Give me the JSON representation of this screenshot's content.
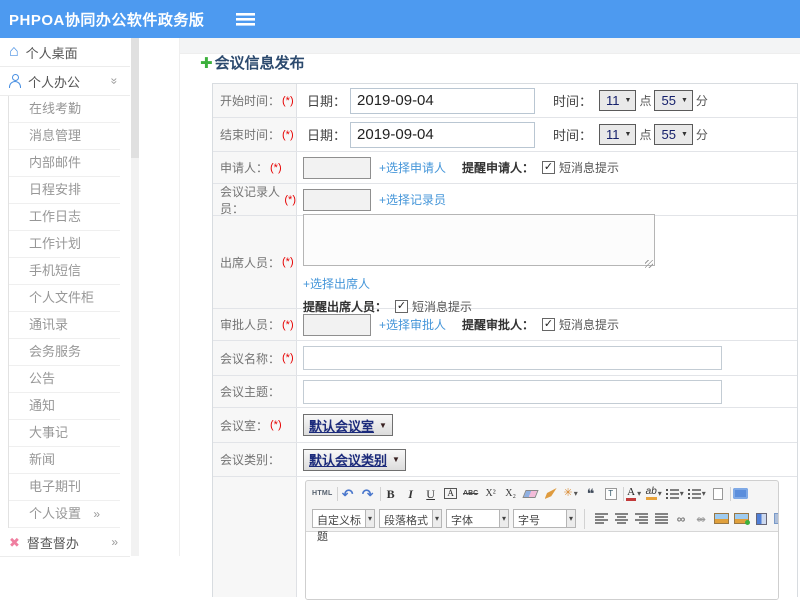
{
  "colors": {
    "header_bg": "#4d9af0",
    "link": "#4596d9",
    "required": "#e60000",
    "title": "#2c4a6e",
    "icon_blue": "#4a90e2",
    "plus_green": "#3cb03c",
    "supervise_pink": "#ef7fa0",
    "select_text": "#1b2a7b"
  },
  "header": {
    "app_title": "PHPOA协同办公软件政务版",
    "menu_icon": "hamburger-icon"
  },
  "sidebar": {
    "desktop": {
      "label": "个人桌面",
      "icon": "home-icon",
      "home_glyph": "⌂"
    },
    "office": {
      "label": "个人办公",
      "icon": "user-icon",
      "chevron": "»"
    },
    "submenu": [
      {
        "name": "sidebar-item-online-attendance",
        "label": "在线考勤"
      },
      {
        "name": "sidebar-item-message-management",
        "label": "消息管理"
      },
      {
        "name": "sidebar-item-internal-mail",
        "label": "内部邮件"
      },
      {
        "name": "sidebar-item-schedule",
        "label": "日程安排"
      },
      {
        "name": "sidebar-item-work-log",
        "label": "工作日志"
      },
      {
        "name": "sidebar-item-work-plan",
        "label": "工作计划"
      },
      {
        "name": "sidebar-item-mobile-sms",
        "label": "手机短信"
      },
      {
        "name": "sidebar-item-personal-cabinet",
        "label": "个人文件柜"
      },
      {
        "name": "sidebar-item-contacts",
        "label": "通讯录"
      },
      {
        "name": "sidebar-item-meeting-service",
        "label": "会务服务"
      },
      {
        "name": "sidebar-item-announcement",
        "label": "公告"
      },
      {
        "name": "sidebar-item-notice",
        "label": "通知"
      },
      {
        "name": "sidebar-item-memorabilia",
        "label": "大事记"
      },
      {
        "name": "sidebar-item-news",
        "label": "新闻"
      },
      {
        "name": "sidebar-item-e-journal",
        "label": "电子期刊"
      },
      {
        "name": "sidebar-item-personal-settings",
        "label": "个人设置",
        "chevron": "»"
      }
    ],
    "supervise": {
      "label": "督查督办",
      "icon": "supervise-icon",
      "glyph": "✖",
      "chevron": "»"
    }
  },
  "page": {
    "title": "会议信息发布",
    "add_glyph": "✚"
  },
  "form": {
    "required": "(*)",
    "start_time": {
      "label": "开始时间：",
      "date_label": "日期：",
      "date": "2019-09-04",
      "time_label": "时间：",
      "hour": "11",
      "hour_unit": "点",
      "minute": "55",
      "minute_unit": "分"
    },
    "end_time": {
      "label": "结束时间：",
      "date_label": "日期：",
      "date": "2019-09-04",
      "time_label": "时间：",
      "hour": "11",
      "hour_unit": "点",
      "minute": "55",
      "minute_unit": "分"
    },
    "applicant": {
      "label": "申请人：",
      "link": "+选择申请人",
      "remind": "提醒申请人：",
      "sms": "短消息提示"
    },
    "recorder": {
      "label": "会议记录人员：",
      "link": "+选择记录员"
    },
    "attendees": {
      "label": "出席人员：",
      "link": "+选择出席人",
      "remind": "提醒出席人员：",
      "sms": "短消息提示"
    },
    "approver": {
      "label": "审批人员：",
      "link": "+选择审批人",
      "remind": "提醒审批人：",
      "sms": "短消息提示"
    },
    "name": {
      "label": "会议名称："
    },
    "topic": {
      "label": "会议主题："
    },
    "room": {
      "label": "会议室：",
      "value": "默认会议室"
    },
    "category": {
      "label": "会议类别：",
      "value": "默认会议类别"
    }
  },
  "editor": {
    "row1": [
      {
        "name": "source-html-button",
        "glyph": "HTML",
        "cls": "tb-html sep-after"
      },
      {
        "name": "undo-icon",
        "glyph": "↶",
        "cls": "tb-arrow"
      },
      {
        "name": "redo-icon",
        "glyph": "↷",
        "cls": "tb-arrow sep-after"
      },
      {
        "name": "bold-icon",
        "glyph": "B",
        "cls": "tb-bold"
      },
      {
        "name": "italic-icon",
        "glyph": "I",
        "cls": "tb-italic"
      },
      {
        "name": "underline-icon",
        "glyph": "U",
        "cls": "tb-underline"
      },
      {
        "name": "font-border-icon",
        "glyph": "A",
        "cls": "tb-abox"
      },
      {
        "name": "strikethrough-icon",
        "glyph": "ABC",
        "cls": "tb-strike"
      },
      {
        "name": "superscript-icon",
        "glyph": "X²",
        "cls": "tb-script"
      },
      {
        "name": "subscript-icon",
        "glyph": "X₂",
        "cls": "tb-script"
      },
      {
        "name": "eraser-icon",
        "glyph": "",
        "cls": "tb-eraser"
      },
      {
        "name": "format-brush-icon",
        "glyph": "",
        "cls": "tb-brush"
      },
      {
        "name": "autotypeset-icon",
        "glyph": "✳",
        "cls": "tb-magic dd"
      },
      {
        "name": "blockquote-icon",
        "glyph": "❝",
        "cls": "tb-quote"
      },
      {
        "name": "paste-text-icon",
        "glyph": "T",
        "cls": "tb-paste sep-after"
      },
      {
        "name": "font-color-icon",
        "glyph": "A",
        "cls": "tb-fontcolor dd"
      },
      {
        "name": "highlight-icon",
        "glyph": "ab",
        "cls": "tb-hilite dd"
      },
      {
        "name": "ordered-list-icon",
        "glyph": "",
        "cls": "tb-ol dd"
      },
      {
        "name": "unordered-list-icon",
        "glyph": "",
        "cls": "tb-ul dd"
      },
      {
        "name": "new-page-icon",
        "glyph": "",
        "cls": "tb-page sep-after"
      },
      {
        "name": "fullscreen-icon",
        "glyph": "",
        "cls": "tb-screen"
      }
    ],
    "row2_selects": [
      {
        "name": "custom-title-select",
        "label": "自定义标题"
      },
      {
        "name": "paragraph-format-select",
        "label": "段落格式"
      },
      {
        "name": "font-family-select",
        "label": "字体"
      },
      {
        "name": "font-size-select",
        "label": "字号"
      }
    ],
    "row2_icons": [
      {
        "name": "align-left-icon",
        "glyph": "",
        "cls": "tb-align al-left"
      },
      {
        "name": "align-center-icon",
        "glyph": "",
        "cls": "tb-align al-center"
      },
      {
        "name": "align-right-icon",
        "glyph": "",
        "cls": "tb-align al-right"
      },
      {
        "name": "align-justify-icon",
        "glyph": "",
        "cls": "tb-align al-justify"
      },
      {
        "name": "link-icon",
        "glyph": "∞",
        "cls": "tb-link"
      },
      {
        "name": "unlink-icon",
        "glyph": "∞",
        "cls": "tb-unlink"
      },
      {
        "name": "image-icon",
        "glyph": "",
        "cls": "tb-image"
      },
      {
        "name": "insert-image-icon",
        "glyph": "",
        "cls": "tb-image plus"
      },
      {
        "name": "media-icon",
        "glyph": "",
        "cls": "tb-media"
      },
      {
        "name": "table-icon",
        "glyph": "",
        "cls": "tb-table"
      }
    ]
  }
}
